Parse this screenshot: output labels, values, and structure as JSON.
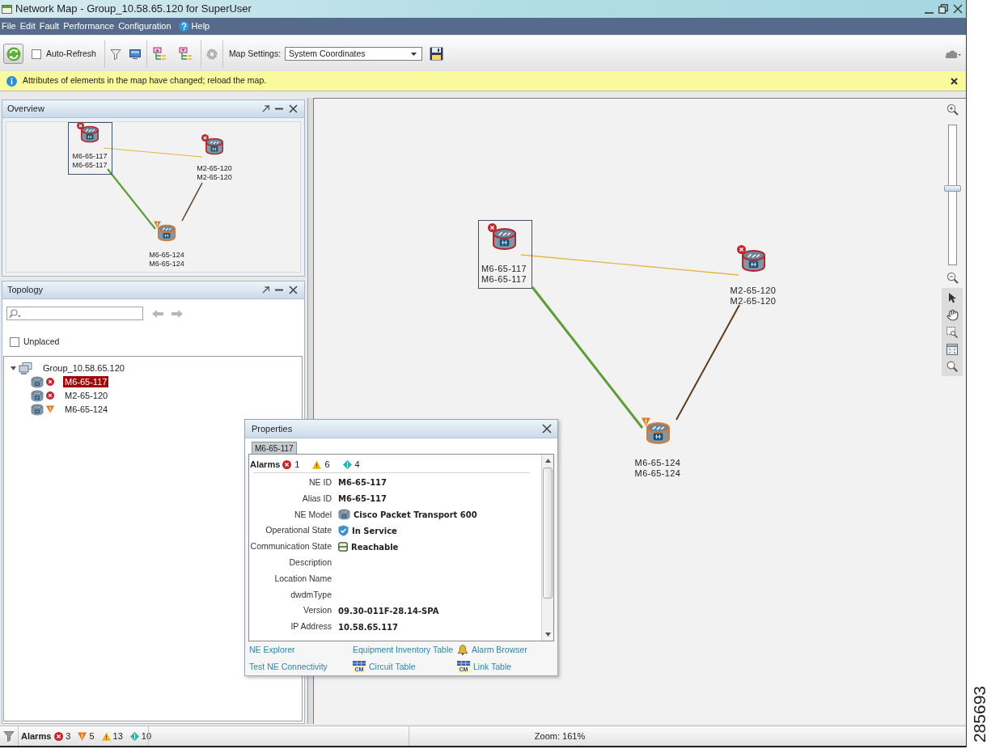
{
  "window": {
    "title": "Network Map - Group_10.58.65.120 for SuperUser"
  },
  "menu": [
    {
      "label": "File",
      "kind": "plain"
    },
    {
      "label": "Edit",
      "kind": "plain"
    },
    {
      "label": "Fault",
      "kind": "plain"
    },
    {
      "label": "Performance",
      "kind": "plain"
    },
    {
      "label": "Configuration",
      "kind": "plain"
    },
    {
      "label": "Help",
      "kind": "help"
    }
  ],
  "toolbar": {
    "auto_refresh": {
      "label": "Auto-Refresh",
      "checked": false
    },
    "map_settings": {
      "label": "Map Settings:",
      "value": "System Coordinates"
    }
  },
  "info_bar": {
    "message": "Attributes of elements in the map have changed; reload the map."
  },
  "overview": {
    "title": "Overview",
    "nodes": [
      {
        "labels": [
          "M6-65-117",
          "M6-65-117"
        ],
        "kind": "critical",
        "selected": true
      },
      {
        "labels": [
          "M2-65-120",
          "M2-65-120"
        ],
        "kind": "critical",
        "selected": false
      },
      {
        "labels": [
          "M6-65-124",
          "M6-65-124"
        ],
        "kind": "major",
        "selected": false
      }
    ],
    "links": [
      {
        "color": "#e6b445"
      },
      {
        "color": "#5d9c36"
      },
      {
        "color": "#5e3d1e"
      }
    ]
  },
  "topology": {
    "title": "Topology",
    "unplaced": {
      "label": "Unplaced",
      "checked": false
    },
    "tree": [
      {
        "label": "Group_10.58.65.120",
        "expanded": true,
        "children": [
          {
            "label": "M6-65-117",
            "kind": "critical",
            "selected": true
          },
          {
            "label": "M2-65-120",
            "kind": "critical",
            "selected": false
          },
          {
            "label": "M6-65-124",
            "kind": "major",
            "selected": false
          }
        ]
      }
    ]
  },
  "map": {
    "nodes": [
      {
        "labels": [
          "M6-65-117",
          "M6-65-117"
        ],
        "kind": "critical",
        "selected": true
      },
      {
        "labels": [
          "M2-65-120",
          "M2-65-120"
        ],
        "kind": "critical",
        "selected": false
      },
      {
        "labels": [
          "M6-65-124",
          "M6-65-124"
        ],
        "kind": "major",
        "selected": false
      }
    ],
    "links": [
      {
        "color": "#e6b445"
      },
      {
        "color": "#5d9c36"
      },
      {
        "color": "#5e3d1e"
      }
    ],
    "zoom_slider": {
      "level": 0.55
    }
  },
  "properties": {
    "title": "Properties",
    "tabs": [
      {
        "label": "M6-65-117",
        "selected": true
      }
    ],
    "alarms_label": "Alarms",
    "alarms": [
      {
        "kind": "critical",
        "count": "1"
      },
      {
        "kind": "minor",
        "count": "6"
      },
      {
        "kind": "warning",
        "count": "4"
      }
    ],
    "fields": [
      {
        "label": "NE ID",
        "value": "M6-65-117",
        "kind": "plain"
      },
      {
        "label": "Alias ID",
        "value": "M6-65-117",
        "kind": "plain"
      },
      {
        "label": "NE Model",
        "value": "Cisco Packet Transport 600",
        "kind": "model"
      },
      {
        "label": "Operational State",
        "value": "In Service",
        "kind": "service"
      },
      {
        "label": "Communication State",
        "value": "Reachable",
        "kind": "connection"
      },
      {
        "label": "Description",
        "kind": "plain"
      },
      {
        "label": "Location Name",
        "kind": "plain"
      },
      {
        "label": "dwdmType",
        "kind": "plain"
      },
      {
        "label": "Version",
        "value": "09.30-011F-28.14-SPA",
        "kind": "plain"
      },
      {
        "label": "IP Address",
        "value": "10.58.65.117",
        "kind": "plain"
      }
    ],
    "links": [
      {
        "label": "NE Explorer",
        "kind": "plain"
      },
      {
        "label": "Equipment Inventory Table",
        "kind": "plain"
      },
      {
        "label": "Alarm Browser",
        "kind": "alarms"
      },
      {
        "label": "Test NE Connectivity",
        "kind": "plain"
      },
      {
        "label": "Circuit Table",
        "kind": "table",
        "icon_text": "CM"
      },
      {
        "label": "Link Table",
        "kind": "table",
        "icon_text": "CM"
      }
    ]
  },
  "status_bar": {
    "alarms_label": "Alarms",
    "alarms": [
      {
        "kind": "critical",
        "count": "3"
      },
      {
        "kind": "major",
        "count": "5"
      },
      {
        "kind": "minor",
        "count": "13"
      },
      {
        "kind": "warning",
        "count": "10"
      }
    ],
    "zoom": "Zoom: 161%"
  },
  "figure_number": "285693"
}
